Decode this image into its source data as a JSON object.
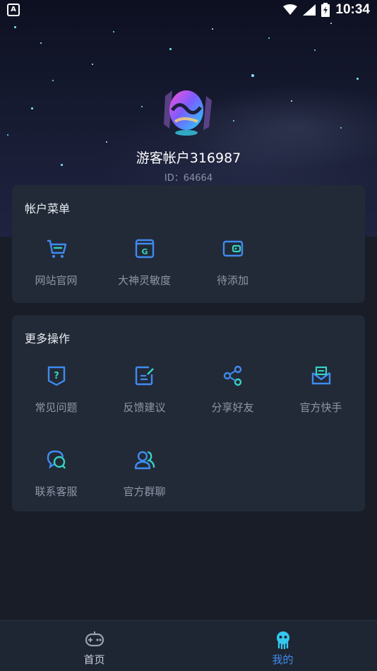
{
  "status_bar": {
    "time": "10:34",
    "notification_icon": "A"
  },
  "profile": {
    "username": "游客帐户316987",
    "id_text": "ID：64664"
  },
  "account_menu": {
    "title": "帐户菜单",
    "items": [
      {
        "label": "网站官网",
        "icon": "cart-icon"
      },
      {
        "label": "大神灵敏度",
        "icon": "g-box-icon"
      },
      {
        "label": "待添加",
        "icon": "wallet-icon"
      }
    ]
  },
  "more_actions": {
    "title": "更多操作",
    "items": [
      {
        "label": "常见问题",
        "icon": "question-shield-icon"
      },
      {
        "label": "反馈建议",
        "icon": "edit-icon"
      },
      {
        "label": "分享好友",
        "icon": "share-icon"
      },
      {
        "label": "官方快手",
        "icon": "mail-icon"
      },
      {
        "label": "联系客服",
        "icon": "chat-icon"
      },
      {
        "label": "官方群聊",
        "icon": "group-icon"
      }
    ]
  },
  "tabbar": {
    "tabs": [
      {
        "label": "首页",
        "icon": "gamepad-icon",
        "active": false
      },
      {
        "label": "我的",
        "icon": "mascot-icon",
        "active": true
      }
    ]
  },
  "colors": {
    "accent": "#3f8bf0",
    "card": "#222a37",
    "background": "#181d28",
    "active_tab": "#3f8bf0"
  }
}
